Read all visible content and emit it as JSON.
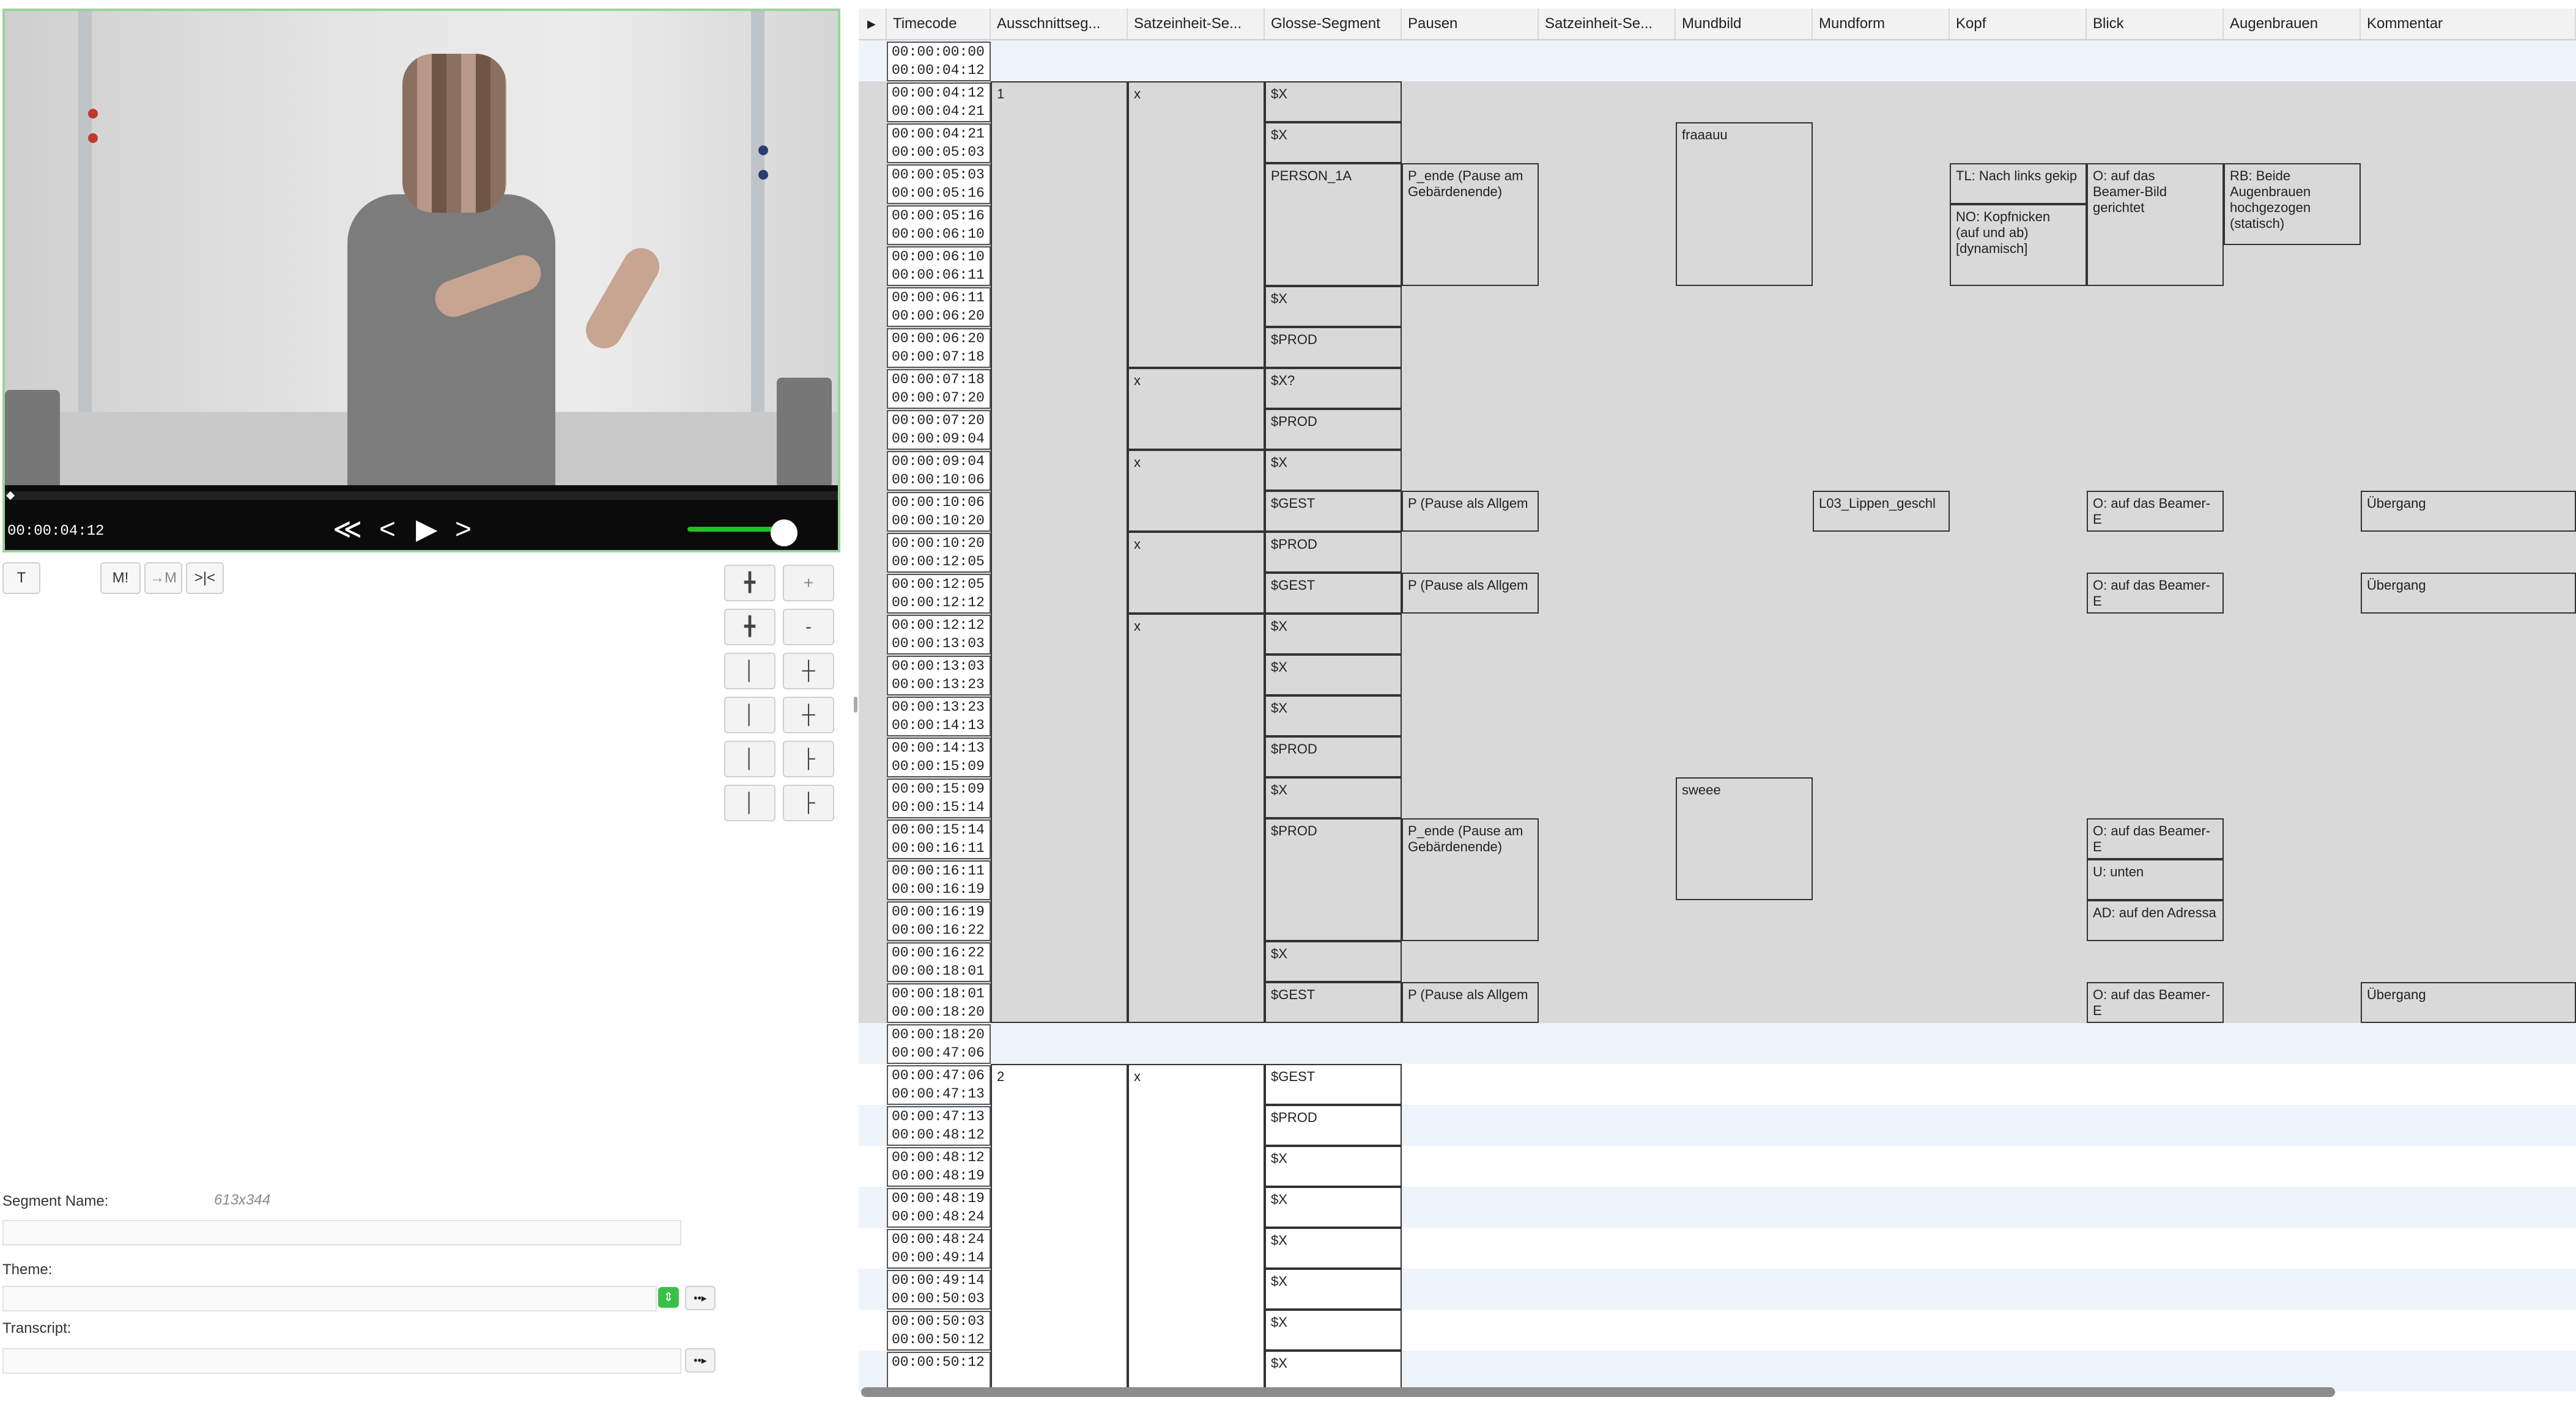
{
  "video": {
    "time": "00:00:04:12",
    "controls": [
      "≪",
      "<",
      "▶",
      ">"
    ]
  },
  "toolbar": {
    "t_label": "T",
    "m_label": "M!",
    "to_m_label": "→M",
    "trim_label": ">|<",
    "plus_label": "+",
    "minus_label": "-"
  },
  "segment_form": {
    "name_label": "Segment Name:",
    "dimensions": "613x344",
    "theme_label": "Theme:",
    "transcript_label": "Transcript:"
  },
  "table": {
    "columns": [
      "Timecode",
      "Ausschnittseg...",
      "Satzeinheit-Se...",
      "Glosse-Segment",
      "Pausen",
      "Satzeinheit-Se...",
      "Mundbild",
      "Mundform",
      "Kopf",
      "Blick",
      "Augenbrauen",
      "Kommentar"
    ],
    "timecodes": [
      [
        "00:00:00:00",
        "00:00:04:12"
      ],
      [
        "00:00:04:12",
        "00:00:04:21"
      ],
      [
        "00:00:04:21",
        "00:00:05:03"
      ],
      [
        "00:00:05:03",
        "00:00:05:16"
      ],
      [
        "00:00:05:16",
        "00:00:06:10"
      ],
      [
        "00:00:06:10",
        "00:00:06:11"
      ],
      [
        "00:00:06:11",
        "00:00:06:20"
      ],
      [
        "00:00:06:20",
        "00:00:07:18"
      ],
      [
        "00:00:07:18",
        "00:00:07:20"
      ],
      [
        "00:00:07:20",
        "00:00:09:04"
      ],
      [
        "00:00:09:04",
        "00:00:10:06"
      ],
      [
        "00:00:10:06",
        "00:00:10:20"
      ],
      [
        "00:00:10:20",
        "00:00:12:05"
      ],
      [
        "00:00:12:05",
        "00:00:12:12"
      ],
      [
        "00:00:12:12",
        "00:00:13:03"
      ],
      [
        "00:00:13:03",
        "00:00:13:23"
      ],
      [
        "00:00:13:23",
        "00:00:14:13"
      ],
      [
        "00:00:14:13",
        "00:00:15:09"
      ],
      [
        "00:00:15:09",
        "00:00:15:14"
      ],
      [
        "00:00:15:14",
        "00:00:16:11"
      ],
      [
        "00:00:16:11",
        "00:00:16:19"
      ],
      [
        "00:00:16:19",
        "00:00:16:22"
      ],
      [
        "00:00:16:22",
        "00:00:18:01"
      ],
      [
        "00:00:18:01",
        "00:00:18:20"
      ],
      [
        "00:00:18:20",
        "00:00:47:06"
      ],
      [
        "00:00:47:06",
        "00:00:47:13"
      ],
      [
        "00:00:47:13",
        "00:00:48:12"
      ],
      [
        "00:00:48:12",
        "00:00:48:19"
      ],
      [
        "00:00:48:19",
        "00:00:48:24"
      ],
      [
        "00:00:48:24",
        "00:00:49:14"
      ],
      [
        "00:00:49:14",
        "00:00:50:03"
      ],
      [
        "00:00:50:03",
        "00:00:50:12"
      ],
      [
        "00:00:50:12",
        ""
      ]
    ],
    "segments": [
      {
        "col": 1,
        "r0": 1,
        "r1": 24,
        "text": "1",
        "white": false
      },
      {
        "col": 2,
        "r0": 1,
        "r1": 8,
        "text": "x",
        "white": false
      },
      {
        "col": 2,
        "r0": 8,
        "r1": 10,
        "text": "x",
        "white": false
      },
      {
        "col": 2,
        "r0": 10,
        "r1": 12,
        "text": "x",
        "white": false
      },
      {
        "col": 2,
        "r0": 12,
        "r1": 14,
        "text": "x",
        "white": false
      },
      {
        "col": 2,
        "r0": 14,
        "r1": 24,
        "text": "x",
        "white": false
      },
      {
        "col": 3,
        "r0": 1,
        "r1": 2,
        "text": "$X",
        "white": false
      },
      {
        "col": 3,
        "r0": 2,
        "r1": 3,
        "text": "$X",
        "white": false
      },
      {
        "col": 3,
        "r0": 3,
        "r1": 6,
        "text": "PERSON_1A",
        "white": false
      },
      {
        "col": 3,
        "r0": 6,
        "r1": 7,
        "text": "$X",
        "white": false
      },
      {
        "col": 3,
        "r0": 7,
        "r1": 8,
        "text": "$PROD",
        "white": false
      },
      {
        "col": 3,
        "r0": 8,
        "r1": 9,
        "text": "$X?",
        "white": false
      },
      {
        "col": 3,
        "r0": 9,
        "r1": 10,
        "text": "$PROD",
        "white": false
      },
      {
        "col": 3,
        "r0": 10,
        "r1": 11,
        "text": "$X",
        "white": false
      },
      {
        "col": 3,
        "r0": 11,
        "r1": 12,
        "text": "$GEST",
        "white": false
      },
      {
        "col": 3,
        "r0": 12,
        "r1": 13,
        "text": "$PROD",
        "white": false
      },
      {
        "col": 3,
        "r0": 13,
        "r1": 14,
        "text": "$GEST",
        "white": false
      },
      {
        "col": 3,
        "r0": 14,
        "r1": 15,
        "text": "$X",
        "white": false
      },
      {
        "col": 3,
        "r0": 15,
        "r1": 16,
        "text": "$X",
        "white": false
      },
      {
        "col": 3,
        "r0": 16,
        "r1": 17,
        "text": "$X",
        "white": false
      },
      {
        "col": 3,
        "r0": 17,
        "r1": 18,
        "text": "$PROD",
        "white": false
      },
      {
        "col": 3,
        "r0": 18,
        "r1": 19,
        "text": "$X",
        "white": false
      },
      {
        "col": 3,
        "r0": 19,
        "r1": 22,
        "text": "$PROD",
        "white": false
      },
      {
        "col": 3,
        "r0": 22,
        "r1": 23,
        "text": "$X",
        "white": false
      },
      {
        "col": 3,
        "r0": 23,
        "r1": 24,
        "text": "$GEST",
        "white": false
      },
      {
        "col": 4,
        "r0": 3,
        "r1": 6,
        "text": "P_ende (Pause am\nGebärdenende)",
        "white": false
      },
      {
        "col": 4,
        "r0": 11,
        "r1": 12,
        "text": "P (Pause als Allgem",
        "white": false
      },
      {
        "col": 4,
        "r0": 13,
        "r1": 14,
        "text": "P (Pause als Allgem",
        "white": false
      },
      {
        "col": 4,
        "r0": 19,
        "r1": 22,
        "text": "P_ende (Pause am\nGebärdenende)",
        "white": false
      },
      {
        "col": 4,
        "r0": 23,
        "r1": 24,
        "text": "P (Pause als Allgem",
        "white": false
      },
      {
        "col": 6,
        "r0": 2,
        "r1": 6,
        "text": "fraaauu",
        "white": false
      },
      {
        "col": 6,
        "r0": 18,
        "r1": 21,
        "text": "sweee",
        "white": false
      },
      {
        "col": 7,
        "r0": 11,
        "r1": 12,
        "text": "L03_Lippen_geschl",
        "white": false
      },
      {
        "col": 8,
        "r0": 3,
        "r1": 4,
        "text": "TL: Nach links gekip",
        "white": false
      },
      {
        "col": 8,
        "r0": 4,
        "r1": 6,
        "text": "NO: Kopfnicken\n(auf und ab)\n[dynamisch]",
        "white": false
      },
      {
        "col": 9,
        "r0": 3,
        "r1": 6,
        "text": "O: auf das\nBeamer-Bild\ngerichtet",
        "white": false
      },
      {
        "col": 9,
        "r0": 11,
        "r1": 12,
        "text": "O: auf das Beamer-E",
        "white": false
      },
      {
        "col": 9,
        "r0": 13,
        "r1": 14,
        "text": "O: auf das Beamer-E",
        "white": false
      },
      {
        "col": 9,
        "r0": 19,
        "r1": 20,
        "text": "O: auf das Beamer-E",
        "white": false
      },
      {
        "col": 9,
        "r0": 20,
        "r1": 21,
        "text": "U: unten",
        "white": false
      },
      {
        "col": 9,
        "r0": 21,
        "r1": 22,
        "text": "AD: auf den Adressa",
        "white": false
      },
      {
        "col": 9,
        "r0": 23,
        "r1": 24,
        "text": "O: auf das Beamer-E",
        "white": false
      },
      {
        "col": 10,
        "r0": 3,
        "r1": 5,
        "text": "RB: Beide\nAugenbrauen\nhochgezogen\n(statisch)",
        "white": false
      },
      {
        "col": 11,
        "r0": 11,
        "r1": 12,
        "text": "Übergang",
        "white": false
      },
      {
        "col": 11,
        "r0": 13,
        "r1": 14,
        "text": "Übergang",
        "white": false
      },
      {
        "col": 11,
        "r0": 23,
        "r1": 24,
        "text": "Übergang",
        "white": false
      },
      {
        "col": 1,
        "r0": 25,
        "r1": 33,
        "text": "2",
        "white": true
      },
      {
        "col": 2,
        "r0": 25,
        "r1": 33,
        "text": "x",
        "white": true
      },
      {
        "col": 3,
        "r0": 25,
        "r1": 26,
        "text": "$GEST",
        "white": true
      },
      {
        "col": 3,
        "r0": 26,
        "r1": 27,
        "text": "$PROD",
        "white": true
      },
      {
        "col": 3,
        "r0": 27,
        "r1": 28,
        "text": "$X",
        "white": true
      },
      {
        "col": 3,
        "r0": 28,
        "r1": 29,
        "text": "$X",
        "white": true
      },
      {
        "col": 3,
        "r0": 29,
        "r1": 30,
        "text": "$X",
        "white": true
      },
      {
        "col": 3,
        "r0": 30,
        "r1": 31,
        "text": "$X",
        "white": true
      },
      {
        "col": 3,
        "r0": 31,
        "r1": 32,
        "text": "$X",
        "white": true
      },
      {
        "col": 3,
        "r0": 32,
        "r1": 33,
        "text": "$X",
        "white": true
      }
    ]
  }
}
